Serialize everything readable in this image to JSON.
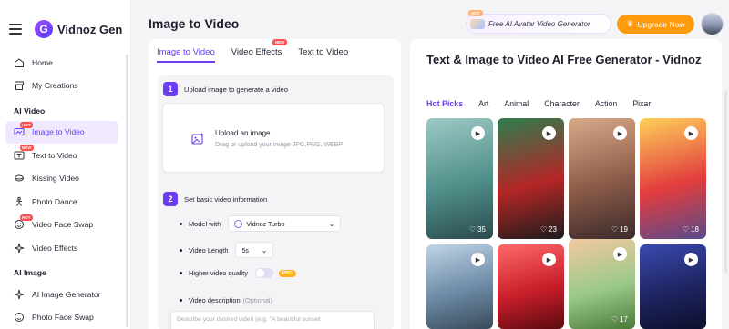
{
  "brand": {
    "name": "Vidnoz Gen",
    "logo_letter": "G"
  },
  "sidebar": {
    "top_items": [
      {
        "label": "Home",
        "icon": "home-icon"
      },
      {
        "label": "My Creations",
        "icon": "archive-icon"
      }
    ],
    "sections": [
      {
        "title": "AI Video",
        "items": [
          {
            "label": "Image to Video",
            "icon": "image-video-icon",
            "badge": "HOT",
            "active": true
          },
          {
            "label": "Text to Video",
            "icon": "text-video-icon",
            "badge": "NEW"
          },
          {
            "label": "Kissing Video",
            "icon": "kiss-icon"
          },
          {
            "label": "Photo Dance",
            "icon": "dance-icon"
          },
          {
            "label": "Video Face Swap",
            "icon": "face-swap-icon",
            "badge": "HOT"
          },
          {
            "label": "Video Effects",
            "icon": "sparkle-icon"
          }
        ]
      },
      {
        "title": "AI Image",
        "items": [
          {
            "label": "AI Image Generator",
            "icon": "sparkle-icon"
          },
          {
            "label": "Photo Face Swap",
            "icon": "face-swap-icon"
          }
        ]
      }
    ]
  },
  "header": {
    "page_title": "Image to Video",
    "promo": {
      "badge": "HOT",
      "label": "Free AI Avatar Video Generator"
    },
    "upgrade_label": "Upgrade Now",
    "upgrade_icon": "crown-icon"
  },
  "left": {
    "tabs": [
      {
        "label": "Image to Video",
        "active": true
      },
      {
        "label": "Video Effects",
        "badge": "NEW"
      },
      {
        "label": "Text to Video"
      }
    ],
    "step1": {
      "number": "1",
      "title": "Upload image to generate a video",
      "upload_title": "Upload an image",
      "upload_hint": "Drag or upload your image JPG,PNG, WEBP"
    },
    "step2": {
      "number": "2",
      "title": "Set basic video information",
      "model_label": "Model with",
      "model_value": "Vidnoz Turbo",
      "length_label": "Video Length",
      "length_value": "5s",
      "quality_label": "Higher video quality",
      "quality_on": false,
      "pro_badge": "PRO",
      "desc_label": "Video description",
      "desc_optional": "(Optional)",
      "desc_placeholder": "Describe your desired video (e.g. \"A beautiful sunset"
    }
  },
  "right": {
    "title": "Text & Image to Video AI Free Generator - Vidnoz",
    "categories": [
      {
        "label": "Hot Picks",
        "active": true
      },
      {
        "label": "Art"
      },
      {
        "label": "Animal"
      },
      {
        "label": "Character"
      },
      {
        "label": "Action"
      },
      {
        "label": "Pixar"
      }
    ],
    "cards": [
      {
        "likes": "35",
        "colors": [
          "#9ec9c4",
          "#4f8f8a",
          "#2c4a4d"
        ]
      },
      {
        "likes": "23",
        "colors": [
          "#2e7d4f",
          "#b32626",
          "#1c1c1c"
        ]
      },
      {
        "likes": "19",
        "colors": [
          "#d9a98a",
          "#8a5a48",
          "#3a2a2a"
        ]
      },
      {
        "likes": "18",
        "colors": [
          "#ffcf5a",
          "#e33d3d",
          "#5a4a8a"
        ]
      },
      {
        "likes": "",
        "colors": [
          "#c0d4e6",
          "#6b8aa5",
          "#3a4a5a"
        ]
      },
      {
        "likes": "",
        "colors": [
          "#ff6a6a",
          "#c81e2a",
          "#5a0a10"
        ]
      },
      {
        "likes": "17",
        "colors": [
          "#f2c9a0",
          "#9bc98a",
          "#4a7a3a"
        ]
      },
      {
        "likes": "",
        "colors": [
          "#3a4ab0",
          "#1e2460",
          "#0c0f2a"
        ]
      }
    ]
  }
}
